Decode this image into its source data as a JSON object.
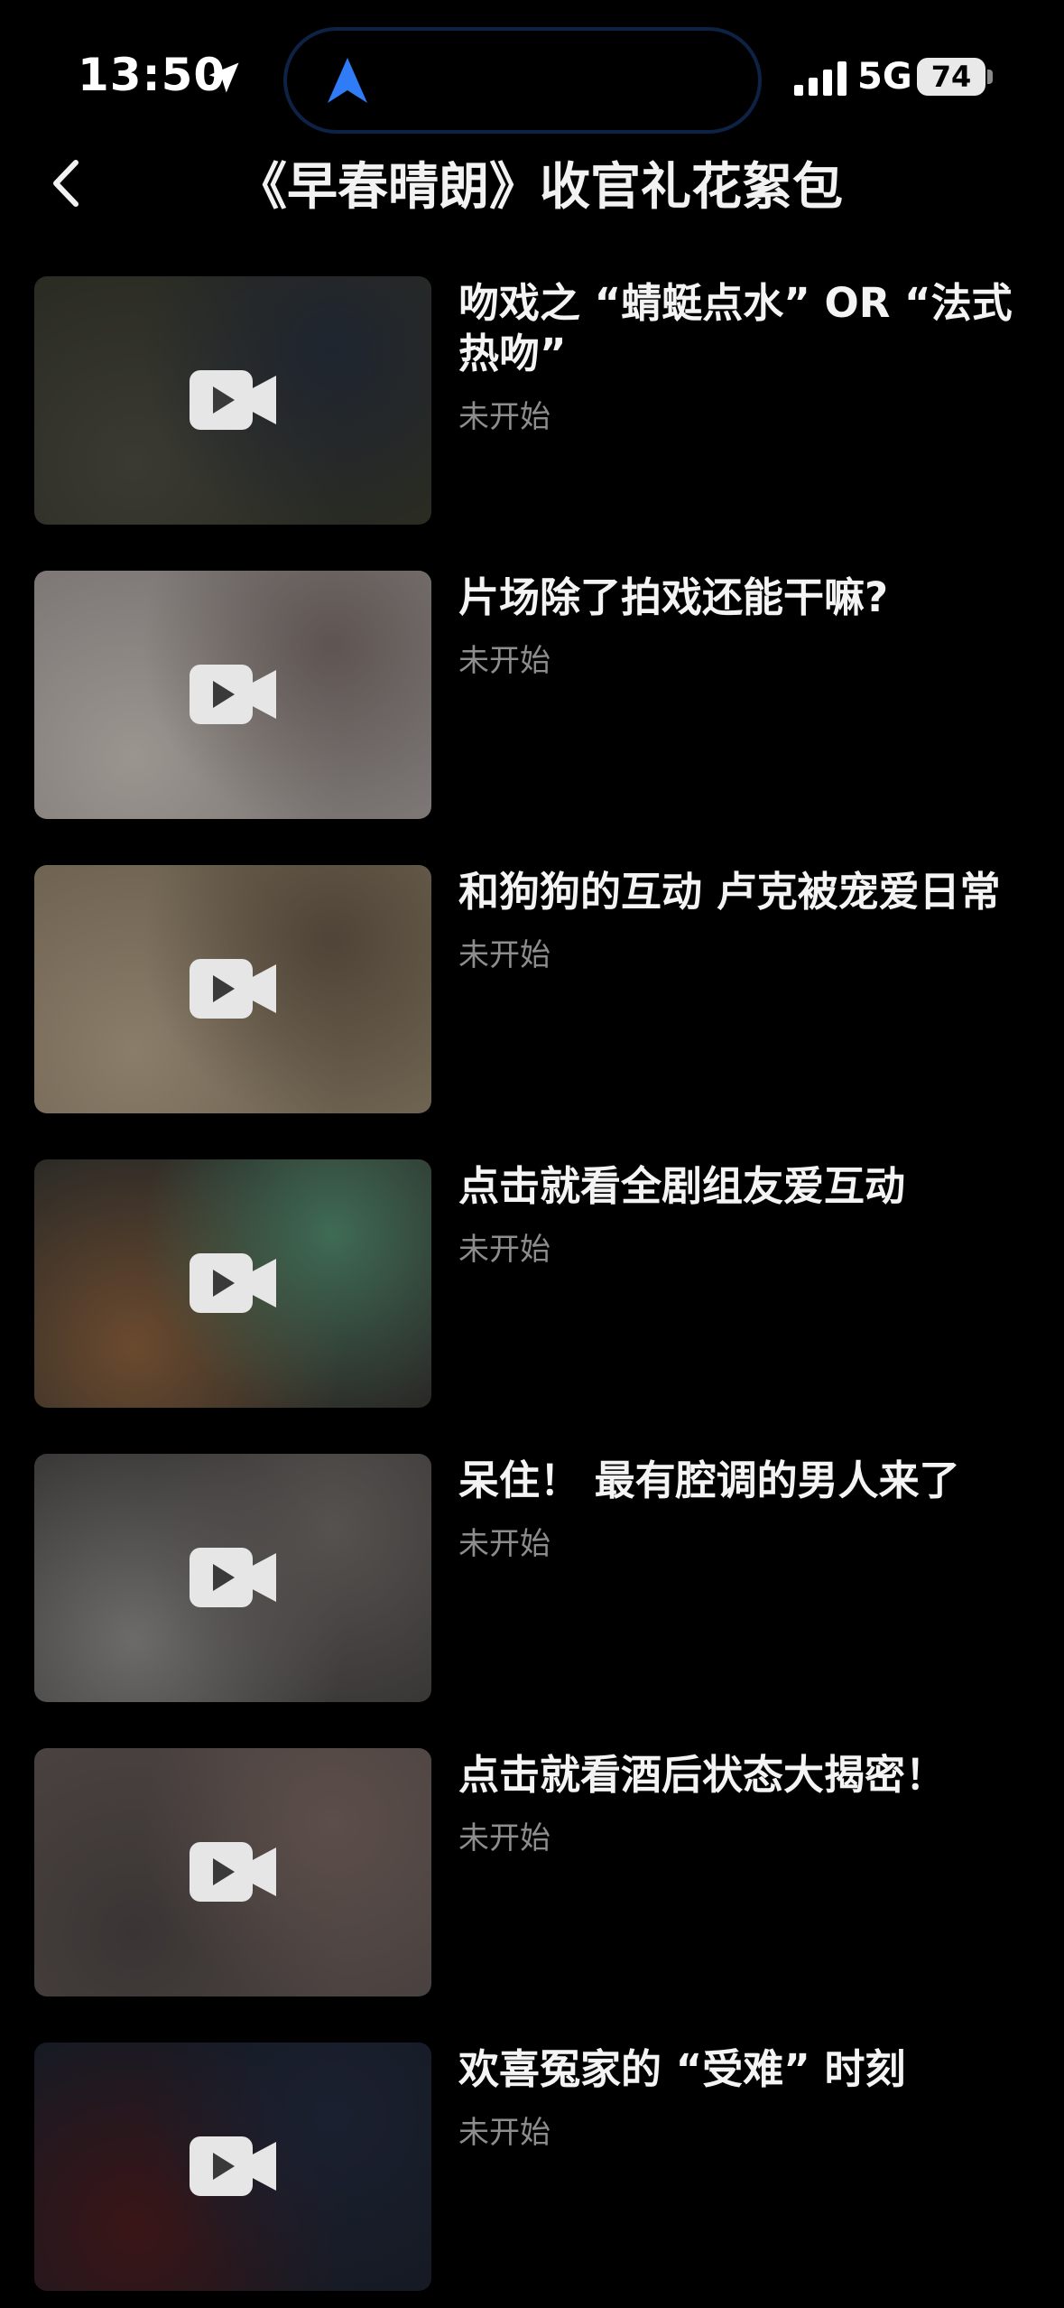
{
  "status_bar": {
    "time": "13:50",
    "network": "5G",
    "battery": "74",
    "icons": [
      "location-arrow-icon",
      "navigation-arrow-icon",
      "signal-bars-icon",
      "battery-icon"
    ]
  },
  "header": {
    "title": "《早春晴朗》收官礼花絮包",
    "back_icon": "chevron-left-icon"
  },
  "videos": [
    {
      "title": "吻戏之 “蜻蜓点水” OR “法式热吻”",
      "status": "未开始",
      "thumb_colors": [
        "#2a2b22",
        "#1f2530",
        "#3a3a33"
      ]
    },
    {
      "title": "片场除了拍戏还能干嘛?",
      "status": "未开始",
      "thumb_colors": [
        "#7c7775",
        "#5e5552",
        "#9b9590"
      ]
    },
    {
      "title": "和狗狗的互动 卢克被宠爱日常",
      "status": "未开始",
      "thumb_colors": [
        "#6e6250",
        "#4f4437",
        "#8a7d6a"
      ]
    },
    {
      "title": "点击就看全剧组友爱互动",
      "status": "未开始",
      "thumb_colors": [
        "#2b2a27",
        "#3f6b55",
        "#6b4a2e"
      ]
    },
    {
      "title": "呆住！ 最有腔调的男人来了",
      "status": "未开始",
      "thumb_colors": [
        "#3a3837",
        "#55524f",
        "#6d6b69"
      ]
    },
    {
      "title": "点击就看酒后状态大揭密！",
      "status": "未开始",
      "thumb_colors": [
        "#4a4240",
        "#5c4e4a",
        "#3a3534"
      ]
    },
    {
      "title": "欢喜冤家的 “受难” 时刻",
      "status": "未开始",
      "thumb_colors": [
        "#161a24",
        "#1b2030",
        "#3a1516"
      ]
    }
  ],
  "colors": {
    "background": "#000000",
    "title_text": "#f4f4f4",
    "status_text": "#8d8d8d",
    "island_border": "#0e2246",
    "nav_arrow": "#2f7cf6"
  }
}
